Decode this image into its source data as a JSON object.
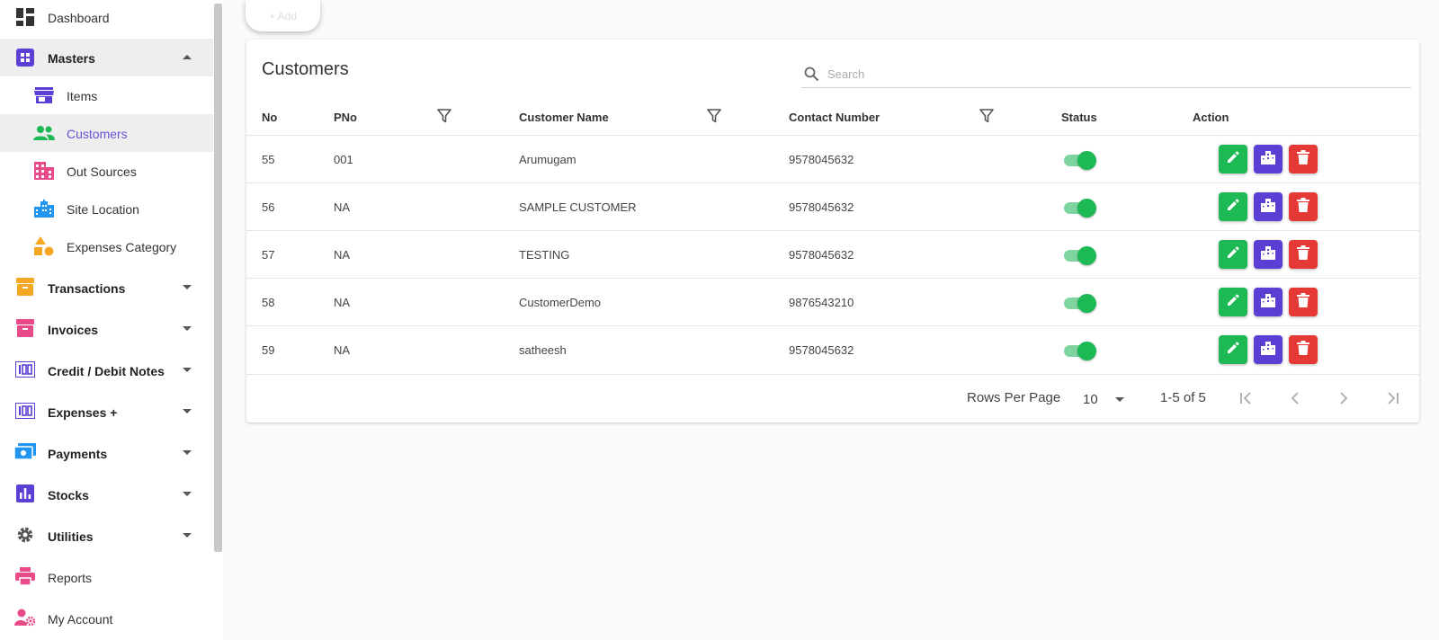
{
  "sidebar": {
    "items": [
      {
        "label": "Dashboard"
      },
      {
        "label": "Masters"
      },
      {
        "label": "Items"
      },
      {
        "label": "Customers"
      },
      {
        "label": "Out Sources"
      },
      {
        "label": "Site Location"
      },
      {
        "label": "Expenses Category"
      },
      {
        "label": "Transactions"
      },
      {
        "label": "Invoices"
      },
      {
        "label": "Credit / Debit Notes"
      },
      {
        "label": "Expenses +"
      },
      {
        "label": "Payments"
      },
      {
        "label": "Stocks"
      },
      {
        "label": "Utilities"
      },
      {
        "label": "Reports"
      },
      {
        "label": "My Account"
      }
    ]
  },
  "toolbar": {
    "add_label": "+ Add"
  },
  "page": {
    "title": "Customers"
  },
  "search": {
    "placeholder": "Search"
  },
  "table": {
    "headers": [
      "No",
      "PNo",
      "Customer Name",
      "Contact Number",
      "Status",
      "Action"
    ],
    "rows": [
      {
        "no": "55",
        "pno": "001",
        "name": "Arumugam",
        "contact": "9578045632",
        "status": true
      },
      {
        "no": "56",
        "pno": "NA",
        "name": "SAMPLE CUSTOMER",
        "contact": "9578045632",
        "status": true
      },
      {
        "no": "57",
        "pno": "NA",
        "name": "TESTING",
        "contact": "9578045632",
        "status": true
      },
      {
        "no": "58",
        "pno": "NA",
        "name": "CustomerDemo",
        "contact": "9876543210",
        "status": true
      },
      {
        "no": "59",
        "pno": "NA",
        "name": "satheesh",
        "contact": "9578045632",
        "status": true
      }
    ]
  },
  "pagination": {
    "rows_per_page_label": "Rows Per Page",
    "rows_per_page": "10",
    "range": "1-5 of 5"
  },
  "colors": {
    "accent": "#6a4fd6",
    "success": "#1db954",
    "danger": "#e53935",
    "primary": "#5b3fd4"
  }
}
